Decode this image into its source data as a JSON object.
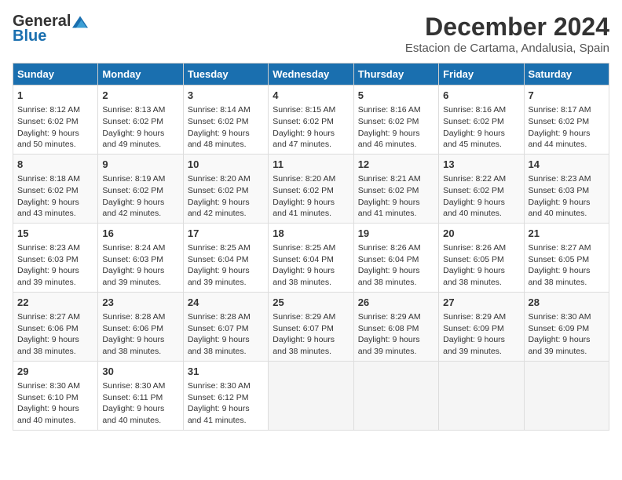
{
  "header": {
    "logo_general": "General",
    "logo_blue": "Blue",
    "month_title": "December 2024",
    "subtitle": "Estacion de Cartama, Andalusia, Spain"
  },
  "weekdays": [
    "Sunday",
    "Monday",
    "Tuesday",
    "Wednesday",
    "Thursday",
    "Friday",
    "Saturday"
  ],
  "weeks": [
    [
      {
        "day": "1",
        "info": "Sunrise: 8:12 AM\nSunset: 6:02 PM\nDaylight: 9 hours and 50 minutes."
      },
      {
        "day": "2",
        "info": "Sunrise: 8:13 AM\nSunset: 6:02 PM\nDaylight: 9 hours and 49 minutes."
      },
      {
        "day": "3",
        "info": "Sunrise: 8:14 AM\nSunset: 6:02 PM\nDaylight: 9 hours and 48 minutes."
      },
      {
        "day": "4",
        "info": "Sunrise: 8:15 AM\nSunset: 6:02 PM\nDaylight: 9 hours and 47 minutes."
      },
      {
        "day": "5",
        "info": "Sunrise: 8:16 AM\nSunset: 6:02 PM\nDaylight: 9 hours and 46 minutes."
      },
      {
        "day": "6",
        "info": "Sunrise: 8:16 AM\nSunset: 6:02 PM\nDaylight: 9 hours and 45 minutes."
      },
      {
        "day": "7",
        "info": "Sunrise: 8:17 AM\nSunset: 6:02 PM\nDaylight: 9 hours and 44 minutes."
      }
    ],
    [
      {
        "day": "8",
        "info": "Sunrise: 8:18 AM\nSunset: 6:02 PM\nDaylight: 9 hours and 43 minutes."
      },
      {
        "day": "9",
        "info": "Sunrise: 8:19 AM\nSunset: 6:02 PM\nDaylight: 9 hours and 42 minutes."
      },
      {
        "day": "10",
        "info": "Sunrise: 8:20 AM\nSunset: 6:02 PM\nDaylight: 9 hours and 42 minutes."
      },
      {
        "day": "11",
        "info": "Sunrise: 8:20 AM\nSunset: 6:02 PM\nDaylight: 9 hours and 41 minutes."
      },
      {
        "day": "12",
        "info": "Sunrise: 8:21 AM\nSunset: 6:02 PM\nDaylight: 9 hours and 41 minutes."
      },
      {
        "day": "13",
        "info": "Sunrise: 8:22 AM\nSunset: 6:02 PM\nDaylight: 9 hours and 40 minutes."
      },
      {
        "day": "14",
        "info": "Sunrise: 8:23 AM\nSunset: 6:03 PM\nDaylight: 9 hours and 40 minutes."
      }
    ],
    [
      {
        "day": "15",
        "info": "Sunrise: 8:23 AM\nSunset: 6:03 PM\nDaylight: 9 hours and 39 minutes."
      },
      {
        "day": "16",
        "info": "Sunrise: 8:24 AM\nSunset: 6:03 PM\nDaylight: 9 hours and 39 minutes."
      },
      {
        "day": "17",
        "info": "Sunrise: 8:25 AM\nSunset: 6:04 PM\nDaylight: 9 hours and 39 minutes."
      },
      {
        "day": "18",
        "info": "Sunrise: 8:25 AM\nSunset: 6:04 PM\nDaylight: 9 hours and 38 minutes."
      },
      {
        "day": "19",
        "info": "Sunrise: 8:26 AM\nSunset: 6:04 PM\nDaylight: 9 hours and 38 minutes."
      },
      {
        "day": "20",
        "info": "Sunrise: 8:26 AM\nSunset: 6:05 PM\nDaylight: 9 hours and 38 minutes."
      },
      {
        "day": "21",
        "info": "Sunrise: 8:27 AM\nSunset: 6:05 PM\nDaylight: 9 hours and 38 minutes."
      }
    ],
    [
      {
        "day": "22",
        "info": "Sunrise: 8:27 AM\nSunset: 6:06 PM\nDaylight: 9 hours and 38 minutes."
      },
      {
        "day": "23",
        "info": "Sunrise: 8:28 AM\nSunset: 6:06 PM\nDaylight: 9 hours and 38 minutes."
      },
      {
        "day": "24",
        "info": "Sunrise: 8:28 AM\nSunset: 6:07 PM\nDaylight: 9 hours and 38 minutes."
      },
      {
        "day": "25",
        "info": "Sunrise: 8:29 AM\nSunset: 6:07 PM\nDaylight: 9 hours and 38 minutes."
      },
      {
        "day": "26",
        "info": "Sunrise: 8:29 AM\nSunset: 6:08 PM\nDaylight: 9 hours and 39 minutes."
      },
      {
        "day": "27",
        "info": "Sunrise: 8:29 AM\nSunset: 6:09 PM\nDaylight: 9 hours and 39 minutes."
      },
      {
        "day": "28",
        "info": "Sunrise: 8:30 AM\nSunset: 6:09 PM\nDaylight: 9 hours and 39 minutes."
      }
    ],
    [
      {
        "day": "29",
        "info": "Sunrise: 8:30 AM\nSunset: 6:10 PM\nDaylight: 9 hours and 40 minutes."
      },
      {
        "day": "30",
        "info": "Sunrise: 8:30 AM\nSunset: 6:11 PM\nDaylight: 9 hours and 40 minutes."
      },
      {
        "day": "31",
        "info": "Sunrise: 8:30 AM\nSunset: 6:12 PM\nDaylight: 9 hours and 41 minutes."
      },
      {
        "day": "",
        "info": ""
      },
      {
        "day": "",
        "info": ""
      },
      {
        "day": "",
        "info": ""
      },
      {
        "day": "",
        "info": ""
      }
    ]
  ]
}
